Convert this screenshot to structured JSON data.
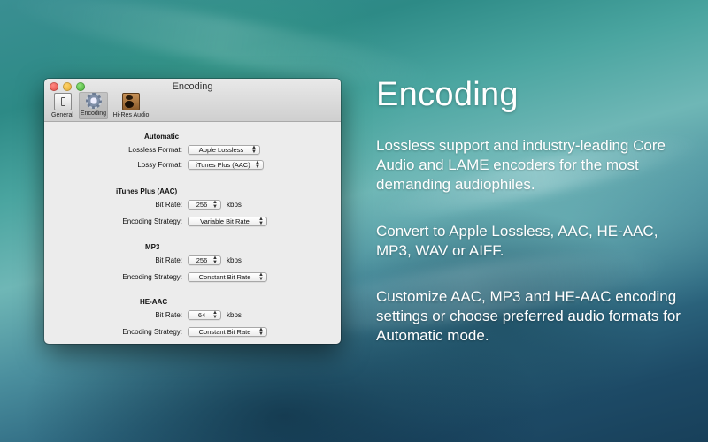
{
  "window": {
    "title": "Encoding",
    "toolbar": [
      {
        "label": "General",
        "icon": "general-icon"
      },
      {
        "label": "Encoding",
        "icon": "gear-icon",
        "selected": true
      },
      {
        "label": "Hi-Res Audio",
        "icon": "speaker-icon"
      }
    ]
  },
  "settings": {
    "automatic": {
      "header": "Automatic",
      "lossless_label": "Lossless Format:",
      "lossless_value": "Apple Lossless",
      "lossy_label": "Lossy Format:",
      "lossy_value": "iTunes Plus (AAC)"
    },
    "itunes_plus": {
      "header": "iTunes Plus (AAC)",
      "bitrate_label": "Bit Rate:",
      "bitrate_value": "256",
      "bitrate_unit": "kbps",
      "strategy_label": "Encoding Strategy:",
      "strategy_value": "Variable Bit Rate"
    },
    "mp3": {
      "header": "MP3",
      "bitrate_label": "Bit Rate:",
      "bitrate_value": "256",
      "bitrate_unit": "kbps",
      "strategy_label": "Encoding Strategy:",
      "strategy_value": "Constant Bit Rate"
    },
    "he_aac": {
      "header": "HE-AAC",
      "bitrate_label": "Bit Rate:",
      "bitrate_value": "64",
      "bitrate_unit": "kbps",
      "strategy_label": "Encoding Strategy:",
      "strategy_value": "Constant Bit Rate"
    }
  },
  "promo": {
    "headline": "Encoding",
    "paragraphs": [
      "Lossless support and industry-leading Core Audio and LAME encoders for the most demanding audiophiles.",
      "Convert to Apple Lossless, AAC, HE-AAC, MP3, WAV or AIFF.",
      "Customize AAC, MP3 and HE-AAC encoding settings or choose preferred audio formats for Automatic mode."
    ]
  }
}
